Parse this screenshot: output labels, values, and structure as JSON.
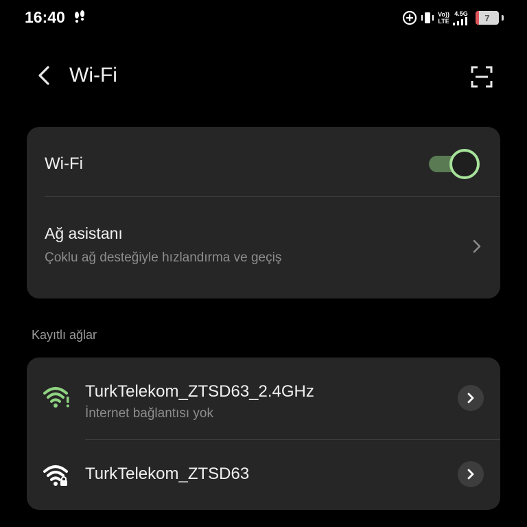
{
  "status_bar": {
    "time": "16:40",
    "network_top": "Vo))",
    "network_bottom": "LTE",
    "network_type": "4.5G",
    "battery_level": "7",
    "icons": [
      "steps-icon",
      "data-saver-icon",
      "vibrate-icon",
      "signal-icon",
      "battery-icon"
    ]
  },
  "header": {
    "title": "Wi-Fi",
    "back_icon": "back-arrow-icon",
    "scan_icon": "qr-scan-icon"
  },
  "wifi_card": {
    "wifi_label": "Wi-Fi",
    "wifi_enabled": true,
    "assistant_title": "Ağ asistanı",
    "assistant_subtitle": "Çoklu ağ desteğiyle hızlandırma ve geçiş"
  },
  "saved_networks": {
    "section_label": "Kayıtlı ağlar",
    "networks": [
      {
        "name": "TurkTelekom_ZTSD63_2.4GHz",
        "status": "İnternet bağlantısı yok",
        "icon": "wifi-warning-icon",
        "icon_color": "#8fd382"
      },
      {
        "name": "TurkTelekom_ZTSD63",
        "status": "",
        "icon": "wifi-lock-icon",
        "icon_color": "#ffffff"
      }
    ]
  },
  "colors": {
    "background": "#000000",
    "card": "#262626",
    "accent": "#a6e29a",
    "toggle_track": "#5a7a53",
    "secondary_text": "#8d8d8d"
  }
}
